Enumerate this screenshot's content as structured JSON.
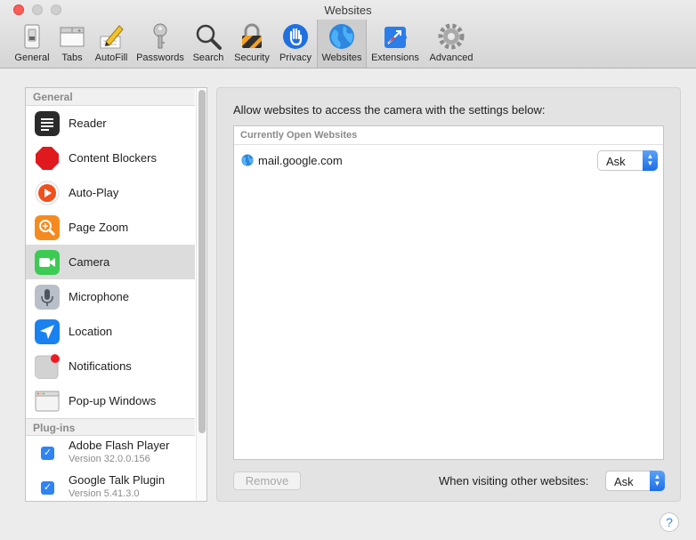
{
  "window": {
    "title": "Websites"
  },
  "toolbar": {
    "items": [
      {
        "label": "General",
        "icon": "general-switch-icon"
      },
      {
        "label": "Tabs",
        "icon": "tabs-icon"
      },
      {
        "label": "AutoFill",
        "icon": "autofill-pencil-icon"
      },
      {
        "label": "Passwords",
        "icon": "key-icon"
      },
      {
        "label": "Search",
        "icon": "magnifier-icon"
      },
      {
        "label": "Security",
        "icon": "lock-icon"
      },
      {
        "label": "Privacy",
        "icon": "hand-icon"
      },
      {
        "label": "Websites",
        "icon": "globe-icon",
        "selected": true
      },
      {
        "label": "Extensions",
        "icon": "puzzle-icon"
      },
      {
        "label": "Advanced",
        "icon": "gear-icon"
      }
    ]
  },
  "sidebar": {
    "general_header": "General",
    "items": [
      {
        "label": "Reader",
        "icon": "reader-icon"
      },
      {
        "label": "Content Blockers",
        "icon": "stop-sign-icon"
      },
      {
        "label": "Auto-Play",
        "icon": "play-icon"
      },
      {
        "label": "Page Zoom",
        "icon": "zoom-icon"
      },
      {
        "label": "Camera",
        "icon": "camera-icon",
        "selected": true
      },
      {
        "label": "Microphone",
        "icon": "microphone-icon"
      },
      {
        "label": "Location",
        "icon": "location-arrow-icon"
      },
      {
        "label": "Notifications",
        "icon": "notifications-icon"
      },
      {
        "label": "Pop-up Windows",
        "icon": "popup-window-icon"
      }
    ],
    "plugins_header": "Plug-ins",
    "plugins": [
      {
        "name": "Adobe Flash Player",
        "version": "Version 32.0.0.156",
        "checked": true
      },
      {
        "name": "Google Talk Plugin",
        "version": "Version 5.41.3.0",
        "checked": true
      }
    ]
  },
  "main": {
    "instruction": "Allow websites to access the camera with the settings below:",
    "list_header": "Currently Open Websites",
    "sites": [
      {
        "name": "mail.google.com",
        "setting": "Ask"
      }
    ],
    "remove_label": "Remove",
    "other_label": "When visiting other websites:",
    "other_setting": "Ask"
  },
  "help": {
    "label": "?"
  },
  "colors": {
    "accent": "#2f84f2",
    "close": "#fd5c56",
    "selected_row": "#dcdcdc"
  }
}
